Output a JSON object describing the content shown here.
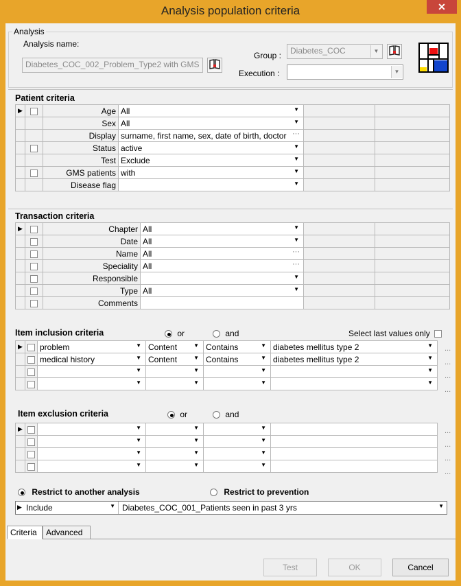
{
  "window": {
    "title": "Analysis population criteria",
    "close": "✕"
  },
  "analysis": {
    "group_caption": "Analysis",
    "name_label": "Analysis name:",
    "name_value": "Diabetes_COC_002_Problem_Type2 with GMS",
    "group_label": "Group :",
    "group_value": "Diabetes_COC",
    "execution_label": "Execution :",
    "execution_value": ""
  },
  "patient": {
    "title": "Patient criteria",
    "rows": [
      {
        "label": "Age",
        "value": "All",
        "has_check": true,
        "control": "dropdown"
      },
      {
        "label": "Sex",
        "value": "All",
        "has_check": false,
        "control": "dropdown"
      },
      {
        "label": "Display",
        "value": "surname, first name, sex, date of birth, doctor",
        "has_check": false,
        "control": "dots"
      },
      {
        "label": "Status",
        "value": "active",
        "has_check": true,
        "control": "dropdown"
      },
      {
        "label": "Test",
        "value": "Exclude",
        "has_check": false,
        "control": "dropdown"
      },
      {
        "label": "GMS patients",
        "value": "with",
        "has_check": true,
        "control": "dropdown"
      },
      {
        "label": "Disease flag",
        "value": "",
        "has_check": false,
        "control": "dropdown"
      }
    ]
  },
  "transaction": {
    "title": "Transaction criteria",
    "rows": [
      {
        "label": "Chapter",
        "value": "All",
        "control": "dropdown"
      },
      {
        "label": "Date",
        "value": "All",
        "control": "dropdown"
      },
      {
        "label": "Name",
        "value": "All",
        "control": "dots"
      },
      {
        "label": "Speciality",
        "value": "All",
        "control": "dots"
      },
      {
        "label": "Responsible",
        "value": "",
        "control": "dropdown"
      },
      {
        "label": "Type",
        "value": "All",
        "control": "dropdown"
      },
      {
        "label": "Comments",
        "value": "",
        "control": "none"
      }
    ]
  },
  "inclusion": {
    "title": "Item inclusion criteria",
    "or_label": "or",
    "and_label": "and",
    "select_last_label": "Select last values only",
    "rows": [
      {
        "item": "problem",
        "field": "Content",
        "op": "Contains",
        "value": "diabetes mellitus type 2"
      },
      {
        "item": "medical history",
        "field": "Content",
        "op": "Contains",
        "value": "diabetes mellitus type 2"
      },
      {
        "item": "",
        "field": "",
        "op": "",
        "value": ""
      },
      {
        "item": "",
        "field": "",
        "op": "",
        "value": ""
      }
    ]
  },
  "exclusion": {
    "title": "Item exclusion criteria",
    "or_label": "or",
    "and_label": "and",
    "rows": [
      {
        "item": "",
        "field": "",
        "op": "",
        "value": ""
      },
      {
        "item": "",
        "field": "",
        "op": "",
        "value": ""
      },
      {
        "item": "",
        "field": "",
        "op": "",
        "value": ""
      },
      {
        "item": "",
        "field": "",
        "op": "",
        "value": ""
      }
    ]
  },
  "restrict": {
    "another_label": "Restrict to another analysis",
    "prevention_label": "Restrict to prevention",
    "mode": "Include",
    "analysis": "Diabetes_COC_001_Patients seen in past 3 yrs"
  },
  "tabs": [
    "Criteria",
    "Advanced"
  ],
  "buttons": {
    "test": "Test",
    "ok": "OK",
    "cancel": "Cancel"
  }
}
